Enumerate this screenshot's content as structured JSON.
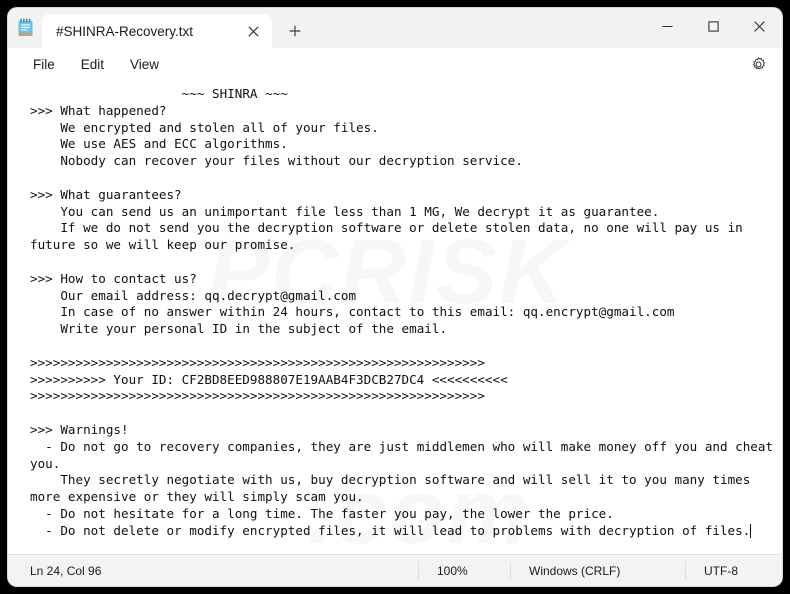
{
  "window": {
    "controls": {
      "minimize": "─",
      "maximize": "□",
      "close": "✕"
    }
  },
  "tabbar": {
    "app_icon": "notepad-icon",
    "tab_title": "#SHINRA-Recovery.txt",
    "close_label": "✕",
    "new_tab_label": "+"
  },
  "menubar": {
    "items": [
      "File",
      "Edit",
      "View"
    ],
    "settings_icon": "gear-icon"
  },
  "editor": {
    "content": "                    ~~~ SHINRA ~~~\n>>> What happened?\n    We encrypted and stolen all of your files.\n    We use AES and ECC algorithms.\n    Nobody can recover your files without our decryption service.\n\n>>> What guarantees?\n    You can send us an unimportant file less than 1 MG, We decrypt it as guarantee.\n    If we do not send you the decryption software or delete stolen data, no one will pay us in future so we will keep our promise.\n\n>>> How to contact us?\n    Our email address: qq.decrypt@gmail.com\n    In case of no answer within 24 hours, contact to this email: qq.encrypt@gmail.com\n    Write your personal ID in the subject of the email.\n\n>>>>>>>>>>>>>>>>>>>>>>>>>>>>>>>>>>>>>>>>>>>>>>>>>>>>>>>>>>>>\n>>>>>>>>>> Your ID: CF2BD8EED988807E19AAB4F3DCB27DC4 <<<<<<<<<<\n>>>>>>>>>>>>>>>>>>>>>>>>>>>>>>>>>>>>>>>>>>>>>>>>>>>>>>>>>>>>\n\n>>> Warnings!\n  - Do not go to recovery companies, they are just middlemen who will make money off you and cheat you.\n    They secretly negotiate with us, buy decryption software and will sell it to you many times more expensive or they will simply scam you.\n  - Do not hesitate for a long time. The faster you pay, the lower the price.\n  - Do not delete or modify encrypted files, it will lead to problems with decryption of files.",
    "ransom_note": {
      "title": "~~~ SHINRA ~~~",
      "victim_id": "CF2BD8EED988807E19AAB4F3DCB27DC4",
      "primary_email": "qq.decrypt@gmail.com",
      "backup_email": "qq.encrypt@gmail.com",
      "encryption": "AES and ECC",
      "test_file_limit": "1 MG",
      "response_window": "24 hours"
    }
  },
  "statusbar": {
    "position": "Ln 24, Col 96",
    "zoom": "100%",
    "line_ending": "Windows (CRLF)",
    "encoding": "UTF-8"
  },
  "watermarks": [
    "PCRISK",
    ".com"
  ]
}
